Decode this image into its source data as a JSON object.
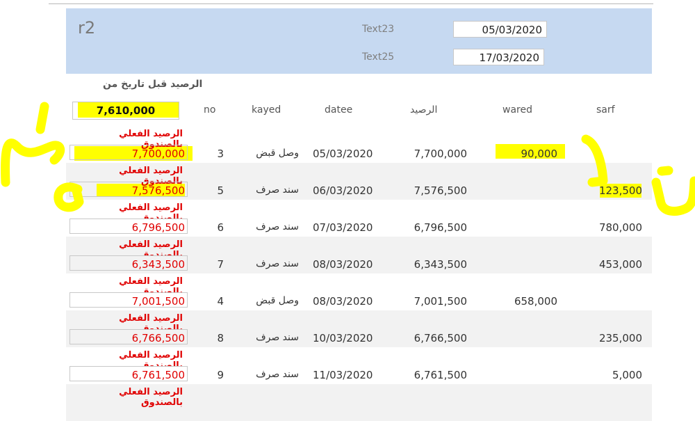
{
  "header": {
    "title": "r2",
    "text23": {
      "label": "Text23",
      "value": "05/03/2020"
    },
    "text25": {
      "label": "Text25",
      "value": "17/03/2020"
    }
  },
  "opening": {
    "label": "الرصيد قبل تاريخ من",
    "value": "7,610,000"
  },
  "columns": {
    "no": "no",
    "kayed": "kayed",
    "datee": "datee",
    "balance": "الرصيد",
    "wared": "wared",
    "sarf": "sarf"
  },
  "rows": [
    {
      "label": "الرصيد الفعلي بالصندوق",
      "box": "7,700,000",
      "no": "3",
      "kayed": "وصل قبض",
      "datee": "05/03/2020",
      "balance": "7,700,000",
      "wared": "90,000",
      "sarf": ""
    },
    {
      "label": "الرصيد الفعلي بالصندوق",
      "box": "7,576,500",
      "no": "5",
      "kayed": "سند صرف",
      "datee": "06/03/2020",
      "balance": "7,576,500",
      "wared": "",
      "sarf": "123,500"
    },
    {
      "label": "الرصيد الفعلي بالصندوق",
      "box": "6,796,500",
      "no": "6",
      "kayed": "سند صرف",
      "datee": "07/03/2020",
      "balance": "6,796,500",
      "wared": "",
      "sarf": "780,000"
    },
    {
      "label": "الرصيد الفعلي بالصندوق",
      "box": "6,343,500",
      "no": "7",
      "kayed": "سند صرف",
      "datee": "08/03/2020",
      "balance": "6,343,500",
      "wared": "",
      "sarf": "453,000"
    },
    {
      "label": "الرصيد الفعلي بالصندوق",
      "box": "7,001,500",
      "no": "4",
      "kayed": "وصل قبض",
      "datee": "08/03/2020",
      "balance": "7,001,500",
      "wared": "658,000",
      "sarf": ""
    },
    {
      "label": "الرصيد الفعلي بالصندوق",
      "box": "6,766,500",
      "no": "8",
      "kayed": "سند صرف",
      "datee": "10/03/2020",
      "balance": "6,766,500",
      "wared": "",
      "sarf": "235,000"
    },
    {
      "label": "الرصيد الفعلي بالصندوق",
      "box": "6,761,500",
      "no": "9",
      "kayed": "سند صرف",
      "datee": "11/03/2020",
      "balance": "6,761,500",
      "wared": "",
      "sarf": "5,000"
    },
    {
      "label": "الرصيد الفعلي بالصندوق",
      "box": "",
      "no": "",
      "kayed": "",
      "datee": "",
      "balance": "",
      "wared": "",
      "sarf": ""
    }
  ],
  "colors": {
    "header_bg": "#c6d9f1",
    "accent_red": "#e00000",
    "highlight": "#ffff00",
    "alt_row": "#f2f2f2"
  },
  "annotations": {
    "marks": [
      "3",
      "5",
      "2",
      "4"
    ]
  }
}
